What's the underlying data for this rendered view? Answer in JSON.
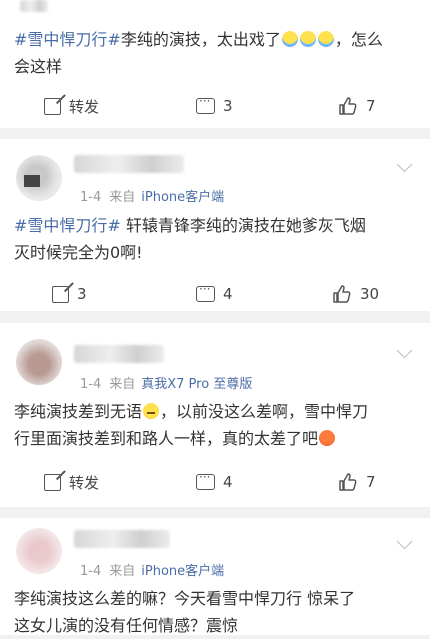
{
  "posts": [
    {
      "text_line1_topic": "#雪中悍刀行#",
      "text_line1_rest": "李纯的演技，太出戏了",
      "text_line1_end": "，怎么",
      "text_line2": "会这样",
      "emojis": [
        "cry-laugh-emoji",
        "cry-laugh-emoji",
        "cry-laugh-emoji"
      ],
      "actions": {
        "share": "转发",
        "comments": "3",
        "likes": "7"
      }
    },
    {
      "meta_time": "1-4",
      "meta_source_prefix": "来自",
      "meta_source": "iPhone客户端",
      "text_line1_topic": "#雪中悍刀行#",
      "text_line1_rest": " 轩辕青锋李纯的演技在她爹灰飞烟",
      "text_line2": "灭时候完全为0啊!",
      "actions": {
        "share": "3",
        "comments": "4",
        "likes": "30"
      }
    },
    {
      "meta_time": "1-4",
      "meta_source_prefix": "来自",
      "meta_source": "真我X7 Pro 至尊版",
      "text_line1_a": "李纯演技差到无语",
      "text_line1_b": "，以前没这么差啊，雪中悍刀",
      "text_line2": "行里面演技差到和路人一样，真的太差了吧",
      "actions": {
        "share": "转发",
        "comments": "4",
        "likes": "7"
      }
    },
    {
      "meta_time": "1-4",
      "meta_source_prefix": "来自",
      "meta_source": "iPhone客户端",
      "text_line1": "李纯演技这么差的嘛？今天看雪中悍刀行  惊呆了",
      "text_line2": "这女儿演的没有任何情感？震惊"
    }
  ]
}
